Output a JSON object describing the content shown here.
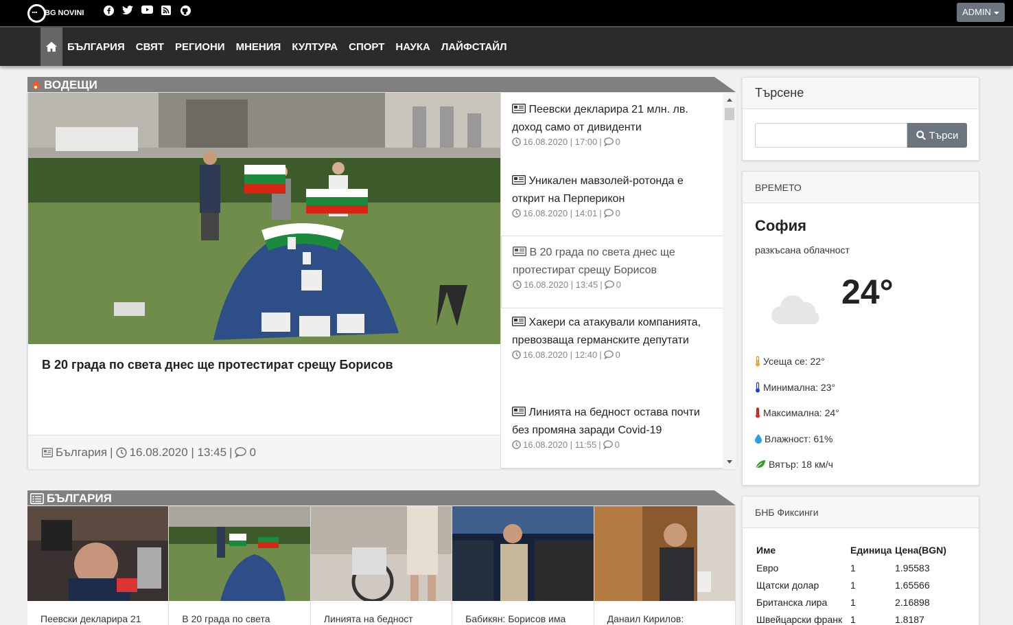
{
  "topbar": {
    "logo_text": "BG NOVINI",
    "social_icons": [
      "facebook-icon",
      "twitter-icon",
      "youtube-icon",
      "rss-icon",
      "github-icon"
    ],
    "admin_label": "ADMIN"
  },
  "nav": {
    "items": [
      "БЪЛГАРИЯ",
      "СВЯТ",
      "РЕГИОНИ",
      "МНЕНИЯ",
      "КУЛТУРА",
      "СПОРТ",
      "НАУКА",
      "ЛАЙФСТАЙЛ"
    ]
  },
  "leading": {
    "heading": "ВОДЕЩИ",
    "main_title": "В 20 града по света днес ще протестират срещу Борисов",
    "main_category": "България",
    "main_datetime": "16.08.2020 | 13:45",
    "main_comments": "0",
    "list": [
      {
        "title": "Пеевски декларира 21 млн. лв. доход само от дивиденти",
        "date": "16.08.2020 | 17:00",
        "comments": "0"
      },
      {
        "title": "Уникален мавзолей-ротонда е открит на Перперикон",
        "date": "16.08.2020 | 14:01",
        "comments": "0"
      },
      {
        "title": "В 20 града по света днес ще протестират срещу Борисов",
        "date": "16.08.2020 | 13:45",
        "comments": "0"
      },
      {
        "title": "Хакери са атакували компанията, превозваща германските депутати",
        "date": "16.08.2020 | 12:40",
        "comments": "0"
      },
      {
        "title": "Линията на бедност остава почти без промяна заради Covid-19",
        "date": "16.08.2020 | 11:55",
        "comments": "0"
      }
    ]
  },
  "bulgaria": {
    "heading": "БЪЛГАРИЯ",
    "items": [
      {
        "caption": "Пеевски декларира 21"
      },
      {
        "caption": "В 20 града по света"
      },
      {
        "caption": "Линията на бедност"
      },
      {
        "caption": "Бабикян: Борисов има"
      },
      {
        "caption": "Данаил Кирилов:"
      }
    ]
  },
  "search": {
    "title": "Търсене",
    "button": "Търси",
    "placeholder": ""
  },
  "weather": {
    "title": "ВРЕМЕТО",
    "city": "София",
    "description": "разкъсана облачност",
    "temperature": "24°",
    "feels_like": "Усеща се: 22°",
    "min": "Минимална: 23°",
    "max": "Максимална: 24°",
    "humidity": "Влажност: 61%",
    "wind": "Вятър: 18 км/ч"
  },
  "rates": {
    "title": "БНБ Фиксинги",
    "headers": [
      "Име",
      "Единица",
      "Цена(BGN)"
    ],
    "rows": [
      [
        "Евро",
        "1",
        "1.95583"
      ],
      [
        "Щатски долар",
        "1",
        "1.65566"
      ],
      [
        "Британска лира",
        "1",
        "2.16898"
      ],
      [
        "Швейцарски франк",
        "1",
        "1.8187"
      ]
    ]
  },
  "colors": {
    "topbar": "#000000",
    "nav": "#2b2b2b",
    "banner": "#808080",
    "accent_flame": "#ff5a1f",
    "button": "#6c757d"
  }
}
